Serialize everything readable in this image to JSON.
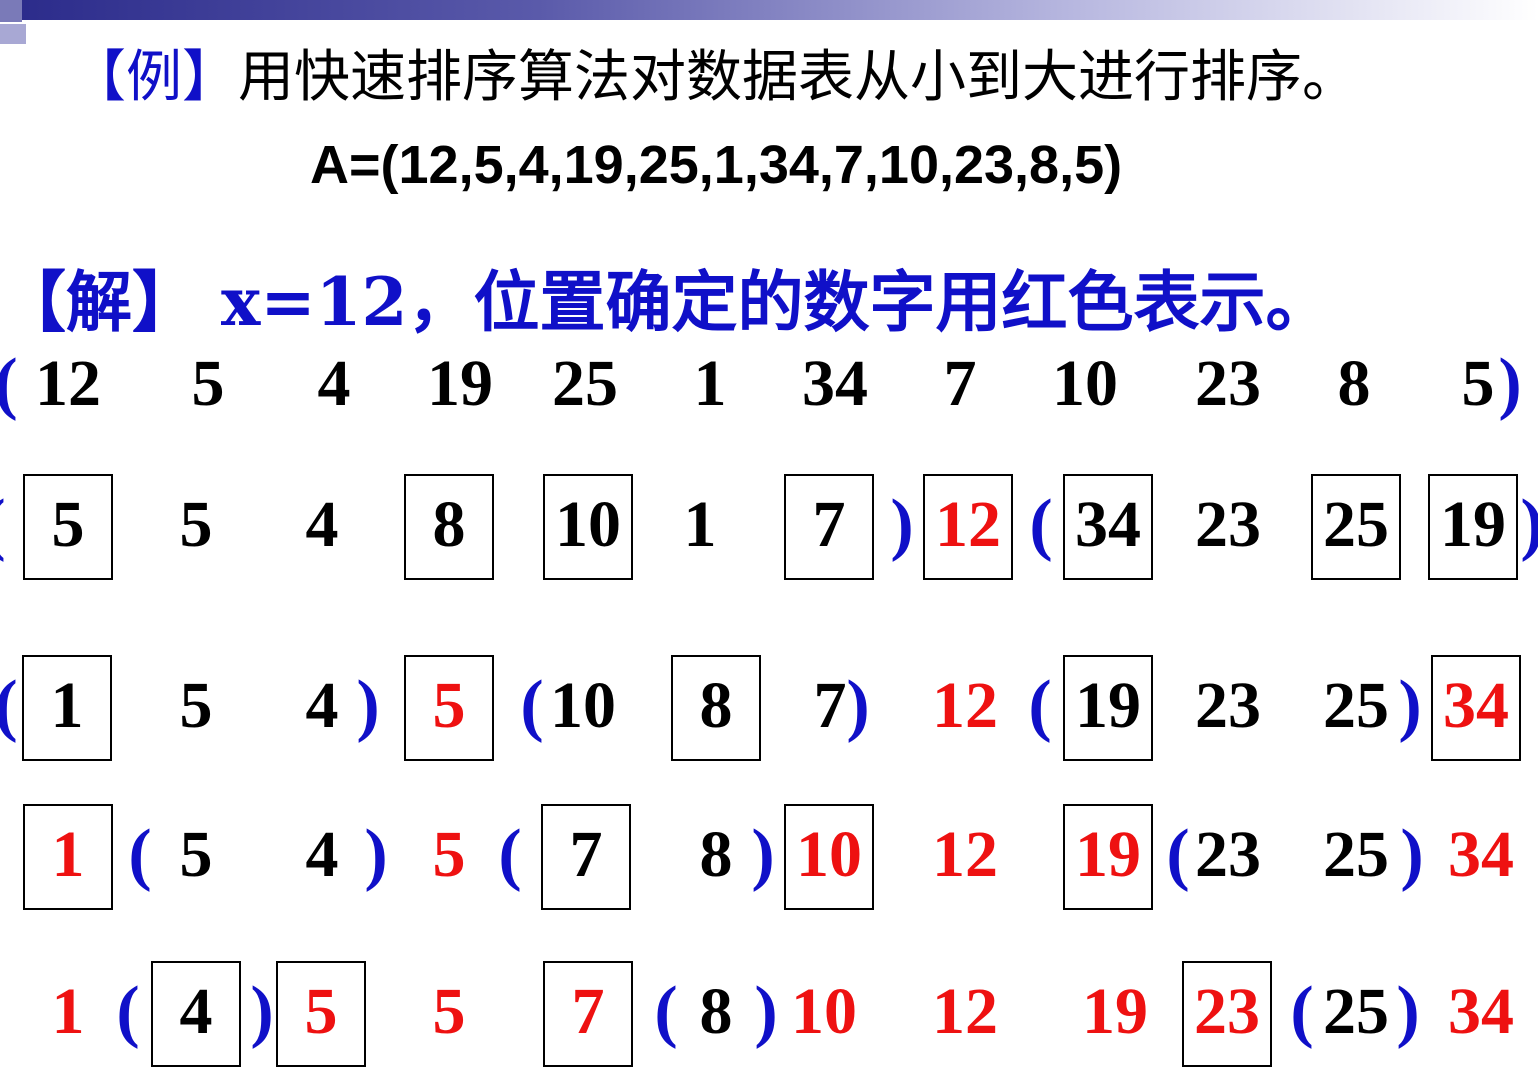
{
  "example": {
    "mark": "【例】",
    "text": "用快速排序算法对数据表从小到大进行排序。"
  },
  "formula": "A=(12,5,4,19,25,1,34,7,10,23,8,5)",
  "solution": {
    "mark": "【解】",
    "text": " x=12，位置确定的数字用红色表示。"
  },
  "rows": [
    [
      {
        "t": "(",
        "k": "paren"
      },
      {
        "t": "12"
      },
      {
        "t": "5"
      },
      {
        "t": "4"
      },
      {
        "t": "19"
      },
      {
        "t": "25"
      },
      {
        "t": "1"
      },
      {
        "t": "34"
      },
      {
        "t": "7"
      },
      {
        "t": "10"
      },
      {
        "t": "23"
      },
      {
        "t": "8"
      },
      {
        "t": "5"
      },
      {
        "t": ")",
        "k": "paren"
      }
    ],
    [
      {
        "t": "(",
        "k": "paren"
      },
      {
        "t": "5",
        "box": true
      },
      {
        "t": "5"
      },
      {
        "t": "4"
      },
      {
        "t": "8",
        "box": true
      },
      {
        "t": "10",
        "box": true
      },
      {
        "t": "1"
      },
      {
        "t": "7",
        "box": true
      },
      {
        "t": ")",
        "k": "paren"
      },
      {
        "t": "12",
        "red": true,
        "box": true
      },
      {
        "t": "(",
        "k": "paren"
      },
      {
        "t": "34",
        "box": true
      },
      {
        "t": "23"
      },
      {
        "t": "25",
        "box": true
      },
      {
        "t": "19",
        "box": true
      },
      {
        "t": ")",
        "k": "paren"
      }
    ],
    [
      {
        "t": "(",
        "k": "paren"
      },
      {
        "t": "1",
        "box": true
      },
      {
        "t": "5"
      },
      {
        "t": "4"
      },
      {
        "t": ")",
        "k": "paren"
      },
      {
        "t": "5",
        "red": true,
        "box": true
      },
      {
        "t": "(",
        "k": "paren"
      },
      {
        "t": "10"
      },
      {
        "t": "8",
        "box": true
      },
      {
        "t": "7"
      },
      {
        "t": ")",
        "k": "paren"
      },
      {
        "t": "12",
        "red": true
      },
      {
        "t": "(",
        "k": "paren"
      },
      {
        "t": "19",
        "box": true
      },
      {
        "t": "23"
      },
      {
        "t": "25"
      },
      {
        "t": ")",
        "k": "paren"
      },
      {
        "t": "34",
        "red": true,
        "box": true
      }
    ],
    [
      {
        "t": "1",
        "red": true,
        "box": true
      },
      {
        "t": "(",
        "k": "paren"
      },
      {
        "t": "5"
      },
      {
        "t": "4"
      },
      {
        "t": ")",
        "k": "paren"
      },
      {
        "t": "5",
        "red": true
      },
      {
        "t": "(",
        "k": "paren"
      },
      {
        "t": "7",
        "box": true
      },
      {
        "t": "8"
      },
      {
        "t": ")",
        "k": "paren"
      },
      {
        "t": "10",
        "red": true,
        "box": true
      },
      {
        "t": "12",
        "red": true
      },
      {
        "t": "19",
        "red": true,
        "box": true
      },
      {
        "t": "(",
        "k": "paren"
      },
      {
        "t": "23"
      },
      {
        "t": "25"
      },
      {
        "t": ")",
        "k": "paren"
      },
      {
        "t": "34",
        "red": true
      }
    ],
    [
      {
        "t": "1",
        "red": true
      },
      {
        "t": "(",
        "k": "paren"
      },
      {
        "t": "4",
        "box": true
      },
      {
        "t": ")",
        "k": "paren"
      },
      {
        "t": "5",
        "red": true,
        "box": true
      },
      {
        "t": "5",
        "red": true
      },
      {
        "t": "7",
        "red": true,
        "box": true
      },
      {
        "t": "(",
        "k": "paren"
      },
      {
        "t": "8"
      },
      {
        "t": ")",
        "k": "paren"
      },
      {
        "t": "10",
        "red": true
      },
      {
        "t": "12",
        "red": true
      },
      {
        "t": "19",
        "red": true
      },
      {
        "t": "23",
        "red": true,
        "box": true
      },
      {
        "t": "(",
        "k": "paren"
      },
      {
        "t": "25"
      },
      {
        "t": ")",
        "k": "paren"
      },
      {
        "t": "34",
        "red": true
      }
    ]
  ]
}
